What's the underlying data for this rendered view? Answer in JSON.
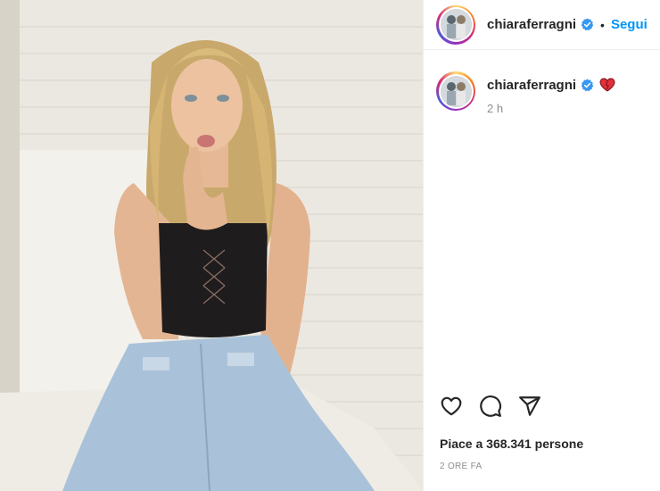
{
  "post": {
    "username": "chiaraferragni",
    "follow_label": "Segui",
    "separator": "•",
    "caption_time": "2 h",
    "likes_text": "Piace a 368.341 persone",
    "posted_ago": "2 ORE FA"
  },
  "icons": {
    "verified": "verified-badge-icon",
    "caption_emoji": "heart-emoji-icon",
    "like": "heart-outline-icon",
    "comment": "comment-bubble-icon",
    "share": "paper-plane-icon"
  },
  "colors": {
    "accent": "#0095f6",
    "verified": "#3897f0",
    "text": "#262626",
    "muted": "#8e8e8e"
  }
}
